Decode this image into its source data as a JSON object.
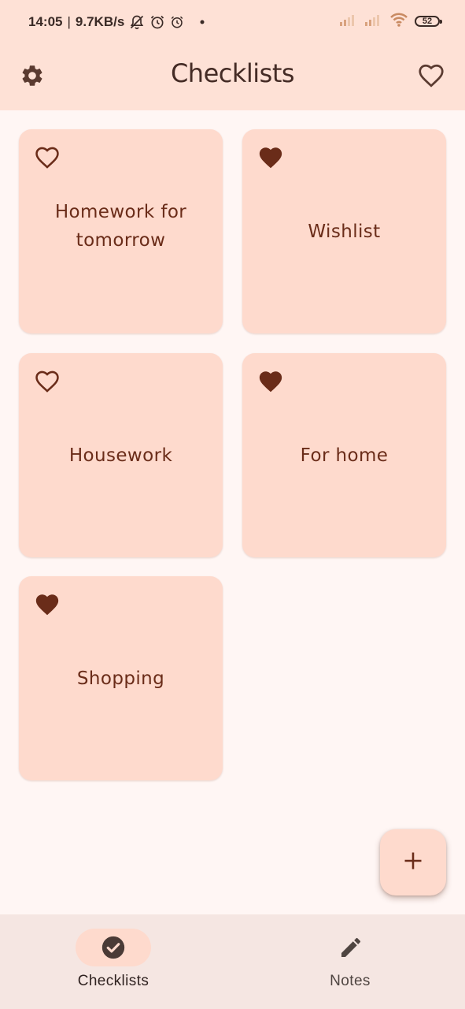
{
  "status_bar": {
    "time": "14:05",
    "separator": "|",
    "speed": "9.7KB/s",
    "battery_level": "52",
    "icons": [
      "mute-bell-icon",
      "alarm-icon",
      "alarm-icon",
      "dot-icon",
      "signal-icon",
      "signal-icon",
      "wifi-icon",
      "battery-icon"
    ]
  },
  "app_bar": {
    "title": "Checklists",
    "left_icon": "gear-icon",
    "right_icon": "heart-outline-icon"
  },
  "checklists": [
    {
      "title": "Homework for tomorrow",
      "favorite": false
    },
    {
      "title": "Wishlist",
      "favorite": true
    },
    {
      "title": "Housework",
      "favorite": false
    },
    {
      "title": "For home",
      "favorite": true
    },
    {
      "title": "Shopping",
      "favorite": true
    }
  ],
  "fab": {
    "icon": "plus-icon"
  },
  "bottom_nav": {
    "items": [
      {
        "label": "Checklists",
        "icon": "check-circle-icon",
        "active": true
      },
      {
        "label": "Notes",
        "icon": "pencil-icon",
        "active": false
      }
    ]
  },
  "colors": {
    "app_bar_bg": "#fee1d6",
    "page_bg": "#fff6f4",
    "card_bg": "#fedacd",
    "card_text": "#6a2c19",
    "heart": "#6a2c19",
    "nav_bg": "#f5e6e2"
  }
}
